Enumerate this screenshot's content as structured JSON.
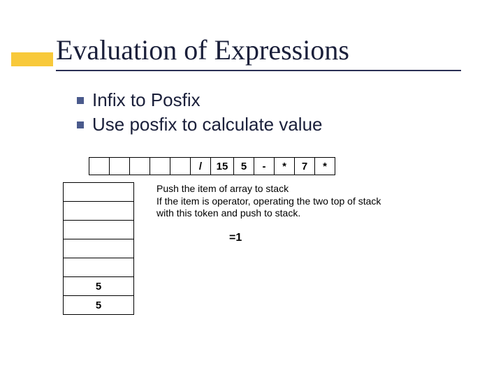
{
  "title": "Evaluation of Expressions",
  "bullets": [
    "Infix to Posfix",
    "Use  posfix to calculate value"
  ],
  "tape": [
    "",
    "",
    "",
    "",
    "",
    "/",
    "15",
    "5",
    "-",
    "*",
    "7",
    "*"
  ],
  "explain_lines": [
    "Push the item of array to stack",
    "If the item is operator, operating the two top of stack",
    "with this token and push to stack."
  ],
  "result": "=1",
  "stack": [
    "",
    "",
    "",
    "",
    "",
    "5",
    "5"
  ],
  "colors": {
    "accent": "#f8c93a",
    "bullet": "#4a5a8c"
  }
}
